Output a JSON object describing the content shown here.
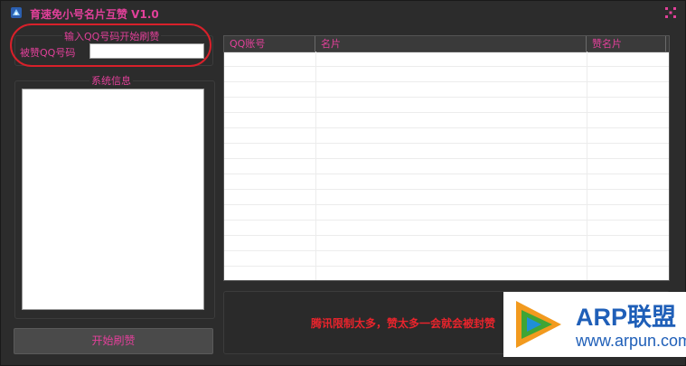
{
  "window": {
    "title": "育速免小号名片互赞 V1.0",
    "accent_color": "#e2409a",
    "alert_color": "#e8242c",
    "close_icon": "close-icon"
  },
  "qq_group": {
    "caption": "输入QQ号码开始刷赞",
    "field_label": "被赞QQ号码",
    "field_value": "",
    "field_placeholder": ""
  },
  "sysinfo": {
    "caption": "系统信息",
    "content": ""
  },
  "actions": {
    "start_label": "开始刷赞"
  },
  "table": {
    "columns": [
      "QQ账号",
      "名片",
      "赞名片"
    ],
    "rows": []
  },
  "status": {
    "message": "腾讯限制太多，赞太多一会就会被封赞"
  },
  "watermark": {
    "brand": "ARP联盟",
    "url": "www.arpun.com"
  }
}
